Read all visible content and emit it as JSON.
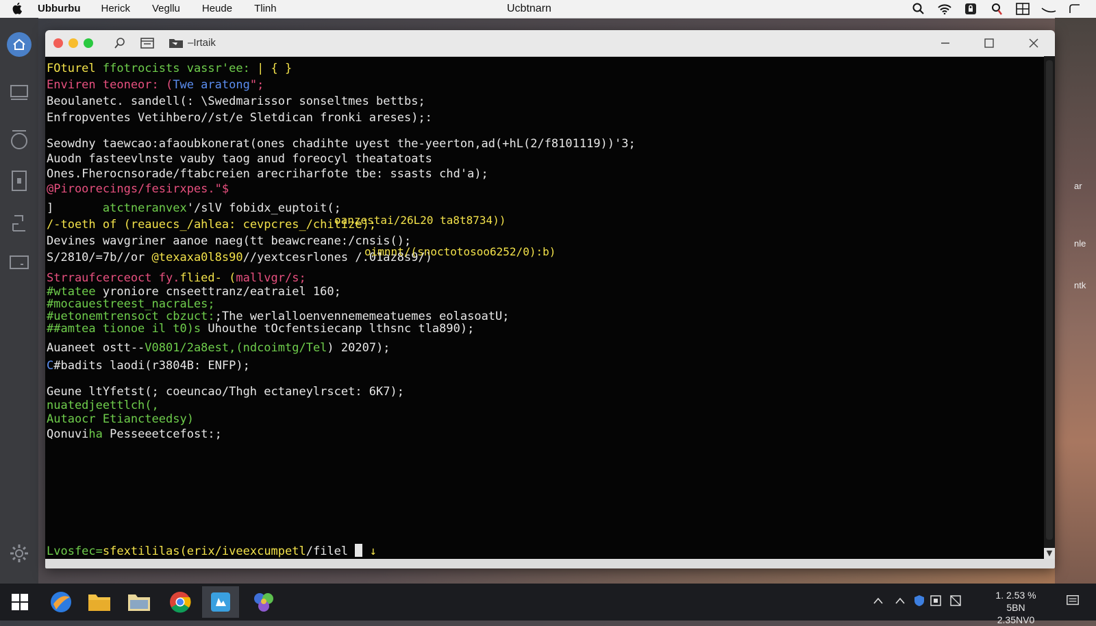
{
  "menubar": {
    "menus": [
      "Ubburbu",
      "Herick",
      "Vegllu",
      "Heude",
      "Tlinh"
    ],
    "center_title": "Ucbtnarn",
    "status_icons": [
      "search-icon",
      "wifi-icon",
      "lock-icon",
      "location-icon",
      "grid-icon",
      "minimize-icon",
      "back-icon"
    ]
  },
  "dock": {
    "items": [
      "home-icon",
      "monitor-icon",
      "circle-icon",
      "document-icon",
      "phone-icon",
      "screen-icon",
      "settings-gear-icon"
    ]
  },
  "window": {
    "title": "–Irtaik",
    "toolbar_icons": [
      "search-icon",
      "window-icon",
      "folder-icon"
    ]
  },
  "terminal": {
    "lines": [
      {
        "segs": [
          {
            "t": "FOturel",
            "c": "y"
          },
          {
            "t": " ffotrocists vassr'ee: ",
            "c": "g"
          },
          {
            "t": "| { }",
            "c": "y"
          }
        ]
      },
      {
        "segs": [
          {
            "t": "Enviren teoneor: (",
            "c": "m"
          },
          {
            "t": "Twe aratong",
            "c": "b"
          },
          {
            "t": "\";",
            "c": "m"
          }
        ]
      },
      {
        "segs": [
          {
            "t": "Beoulanetc. sandell(: \\Swedmarissor sonseltmes bettbs;",
            "c": "w"
          }
        ]
      },
      {
        "segs": [
          {
            "t": "Enfropventes Vetihbero//st/e Sletdican fronki areses);:",
            "c": "w"
          }
        ]
      },
      {
        "segs": [
          {
            "t": "Seowdny taewcao:afaoubkonerat(ones chadihte uyest the-yeerton,ad(+hL(2/f8101119))'3;",
            "c": "w"
          }
        ]
      },
      {
        "segs": [
          {
            "t": "Auodn fasteevlnste vauby taog anud foreocyl theatatoats",
            "c": "w"
          }
        ]
      },
      {
        "segs": [
          {
            "t": "Ones.Fherocnsorade/ftabcreien arecriharfote tbe: ssasts chd'a);",
            "c": "w"
          }
        ]
      },
      {
        "segs": [
          {
            "t": "@Piroorecings/fesirxpes.\"$",
            "c": "m"
          }
        ]
      },
      {
        "segs": [
          {
            "t": "]       ",
            "c": "w"
          },
          {
            "t": "atctneranvex",
            "c": "g"
          },
          {
            "t": "'/slV fobidx_euptoit(;",
            "c": "w"
          }
        ]
      },
      {
        "segs": [
          {
            "t": "/-toeth of (",
            "c": "y"
          },
          {
            "t": "reauecs_/ahlea: cevpcres_/chitize);",
            "c": "y"
          }
        ]
      },
      {
        "segs": [
          {
            "t": "Devines wavgriner aanoe naeg(tt beawcreane:/cnsis();",
            "c": "w"
          }
        ]
      },
      {
        "segs": [
          {
            "t": "S/2810/=7b//or ",
            "c": "w"
          },
          {
            "t": "@texaxa0l8s90",
            "c": "y"
          },
          {
            "t": "//yextcesrlones /.01az8s9/)",
            "c": "w"
          }
        ]
      },
      {
        "segs": [
          {
            "t": "Strraufcerceoct fy.",
            "c": "m"
          },
          {
            "t": "flied- (",
            "c": "y"
          },
          {
            "t": "mallvgr/s;",
            "c": "m"
          }
        ]
      },
      {
        "segs": [
          {
            "t": "#wtatee",
            "c": "g"
          },
          {
            "t": " yroniore cnseettranz/eatraiel 160;",
            "c": "w"
          }
        ]
      },
      {
        "segs": [
          {
            "t": "#mocauestreest_nacraLes;",
            "c": "g"
          }
        ]
      },
      {
        "segs": [
          {
            "t": "#uetonemtrensoct cbzuct:",
            "c": "g"
          },
          {
            "t": ";The werlalloenvennememeatuemes eolasoatU;",
            "c": "w"
          }
        ]
      },
      {
        "segs": [
          {
            "t": "##amtea tionoe il t0)s",
            "c": "g"
          },
          {
            "t": " Uhouthe tOcfentsiecanp lthsnc tla890);",
            "c": "w"
          }
        ]
      },
      {
        "segs": [
          {
            "t": "Auaneet ostt--",
            "c": "w"
          },
          {
            "t": "V0801/2a8est,",
            "c": "g"
          },
          {
            "t": "(ndcoimtg/Tel",
            "c": "g"
          },
          {
            "t": ") 20207);",
            "c": "w"
          }
        ]
      },
      {
        "segs": [
          {
            "t": "C",
            "c": "b"
          },
          {
            "t": "#badits laodi(r3804B: ENFP);",
            "c": "w"
          }
        ]
      },
      {
        "segs": [
          {
            "t": "Geune ltYfetst(; coeuncao/Thgh ectaneylrscet: 6K7);",
            "c": "w"
          }
        ]
      },
      {
        "segs": [
          {
            "t": "nuatedjeettlch(,",
            "c": "g"
          }
        ]
      },
      {
        "segs": [
          {
            "t": "Autaocr Etiancteedsy)",
            "c": "g"
          }
        ]
      },
      {
        "segs": [
          {
            "t": "Qonuvi",
            "c": "w"
          },
          {
            "t": "ha ",
            "c": "g"
          },
          {
            "t": "Pesseeetcefost:;",
            "c": "w"
          }
        ]
      }
    ],
    "overlays": [
      {
        "t": "oanzestai/26L20 ta8t8734))",
        "c": "y"
      },
      {
        "t": "oimnnt/(snoctotosoo6252/0):b)",
        "c": "y"
      }
    ],
    "prompt": [
      {
        "t": "Lvosfec=",
        "c": "g"
      },
      {
        "t": "sfextililas(",
        "c": "y"
      },
      {
        "t": "erix/ive",
        "c": "y"
      },
      {
        "t": "excumpetl",
        "c": "y"
      },
      {
        "t": "/filel ",
        "c": "w"
      }
    ],
    "prompt_tail": "↓"
  },
  "taskbar": {
    "apps": [
      "windows-start-icon",
      "browser-icon",
      "folder-icon",
      "explorer-icon",
      "chrome-icon",
      "active-app-icon",
      "network-icon"
    ],
    "tray_icons": [
      "caret-up-icon",
      "caret-up-icon",
      "shield-icon",
      "device-icon",
      "box-icon"
    ],
    "clock_line1": "1. 2.53 %",
    "clock_line2": "5BN 2.35NV0",
    "notification_icon": "notification-icon"
  },
  "background": {
    "right_text_1": "ar",
    "right_text_2": "nle",
    "right_text_3": "ntk"
  }
}
